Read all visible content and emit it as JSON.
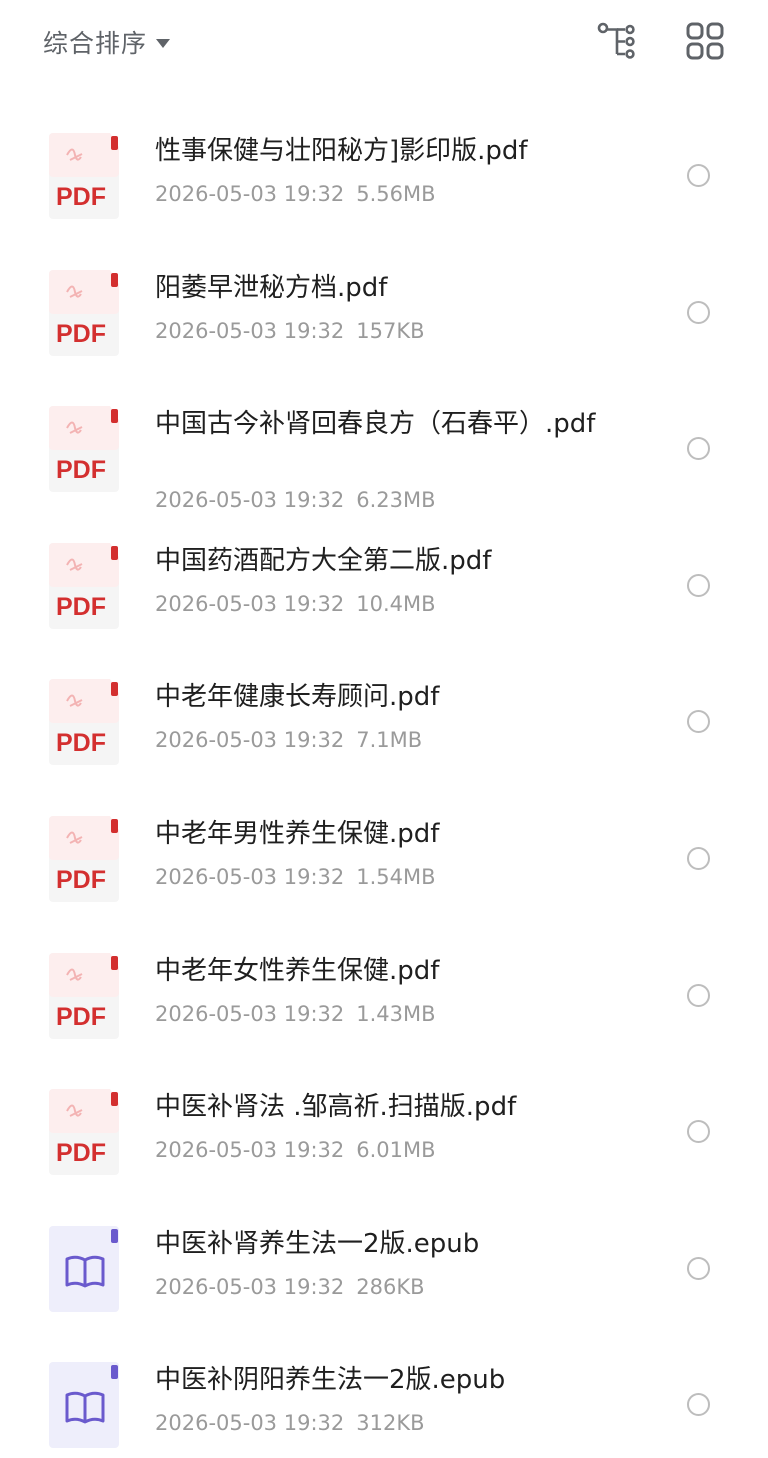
{
  "toolbar": {
    "sort_label": "综合排序",
    "icons": [
      "tree-view-icon",
      "grid-view-icon"
    ]
  },
  "file_type_labels": {
    "pdf": "PDF"
  },
  "colors": {
    "pdf_accent": "#d32f2f",
    "epub_accent": "#6a5acd",
    "epub_bg": "#eeeefb",
    "meta_text": "#9a9a9a"
  },
  "files": [
    {
      "name": "性事保健与壮阳秘方]影印版.pdf",
      "date": "2026-05-03 19:32",
      "size": "5.56MB",
      "type": "pdf"
    },
    {
      "name": "阳萎早泄秘方档.pdf",
      "date": "2026-05-03 19:32",
      "size": "157KB",
      "type": "pdf"
    },
    {
      "name": "中国古今补肾回春良方（石春平）.pdf",
      "date": "2026-05-03 19:32",
      "size": "6.23MB",
      "type": "pdf"
    },
    {
      "name": "中国药酒配方大全第二版.pdf",
      "date": "2026-05-03 19:32",
      "size": "10.4MB",
      "type": "pdf"
    },
    {
      "name": "中老年健康长寿顾问.pdf",
      "date": "2026-05-03 19:32",
      "size": "7.1MB",
      "type": "pdf"
    },
    {
      "name": "中老年男性养生保健.pdf",
      "date": "2026-05-03 19:32",
      "size": "1.54MB",
      "type": "pdf"
    },
    {
      "name": "中老年女性养生保健.pdf",
      "date": "2026-05-03 19:32",
      "size": "1.43MB",
      "type": "pdf"
    },
    {
      "name": "中医补肾法 .邹高祈.扫描版.pdf",
      "date": "2026-05-03 19:32",
      "size": "6.01MB",
      "type": "pdf"
    },
    {
      "name": "中医补肾养生法一2版.epub",
      "date": "2026-05-03 19:32",
      "size": "286KB",
      "type": "epub"
    },
    {
      "name": "中医补阴阳养生法一2版.epub",
      "date": "2026-05-03 19:32",
      "size": "312KB",
      "type": "epub"
    }
  ]
}
